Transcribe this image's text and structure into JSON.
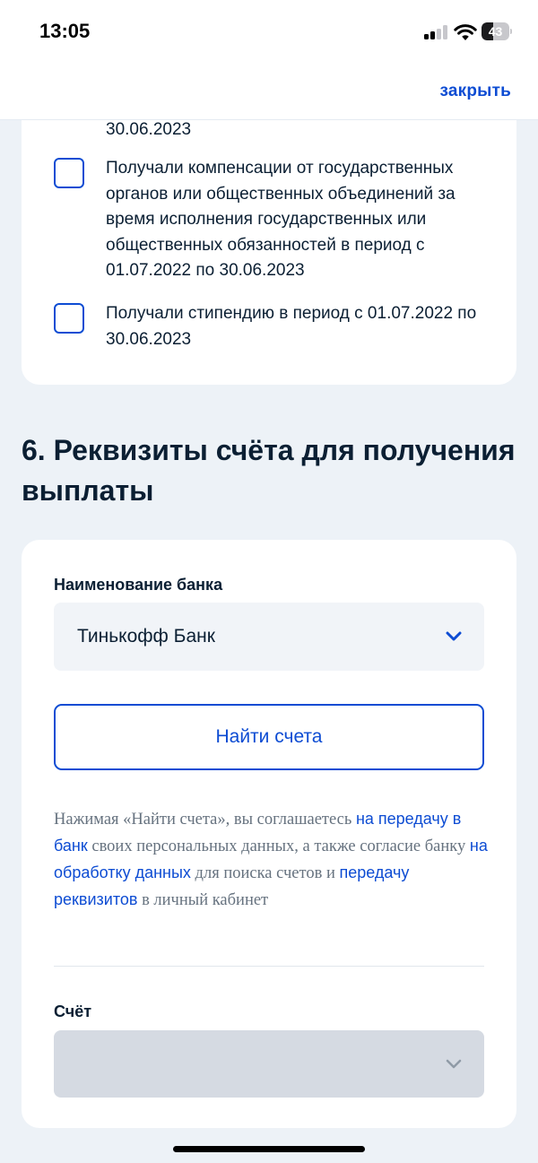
{
  "status_bar": {
    "time": "13:05",
    "battery_level": "43",
    "battery_fraction": 0.43,
    "signal_bars_active": 2,
    "signal_bars_total": 4,
    "icons": [
      "cellular-signal-icon",
      "wifi-icon",
      "battery-icon"
    ]
  },
  "nav": {
    "close_label": "закрыть"
  },
  "benefits_card": {
    "clipped_text": "30.06.2023",
    "items": [
      {
        "label": "Получали компенсации от государственных органов или общественных объединений за время исполнения государственных или общественных обязанностей в период с 01.07.2022 по 30.06.2023",
        "checked": false
      },
      {
        "label": "Получали стипендию в период с 01.07.2022 по 30.06.2023",
        "checked": false
      }
    ]
  },
  "section": {
    "title": "6. Реквизиты счёта для получения выплаты"
  },
  "bank_form": {
    "bank_label": "Наименование банка",
    "bank_value": "Тинькофф Банк",
    "find_button_label": "Найти счета",
    "consent": {
      "part1": "Нажимая «Найти счета», вы соглашаетесь ",
      "link1": "на передачу в банк",
      "part2": " своих персональных данных, а также согласие банку ",
      "link2": "на обработку данных",
      "part3": " для поиска счетов и ",
      "link3": "передачу реквизитов",
      "part4": " в личный кабинет"
    },
    "account_label": "Счёт",
    "account_value": ""
  },
  "colors": {
    "accent": "#0d4cd3",
    "text": "#0b1f33",
    "muted_text": "#66727f",
    "page_background": "#edf2f7",
    "input_background": "#f1f4f8",
    "disabled_background": "#d5dae2"
  }
}
